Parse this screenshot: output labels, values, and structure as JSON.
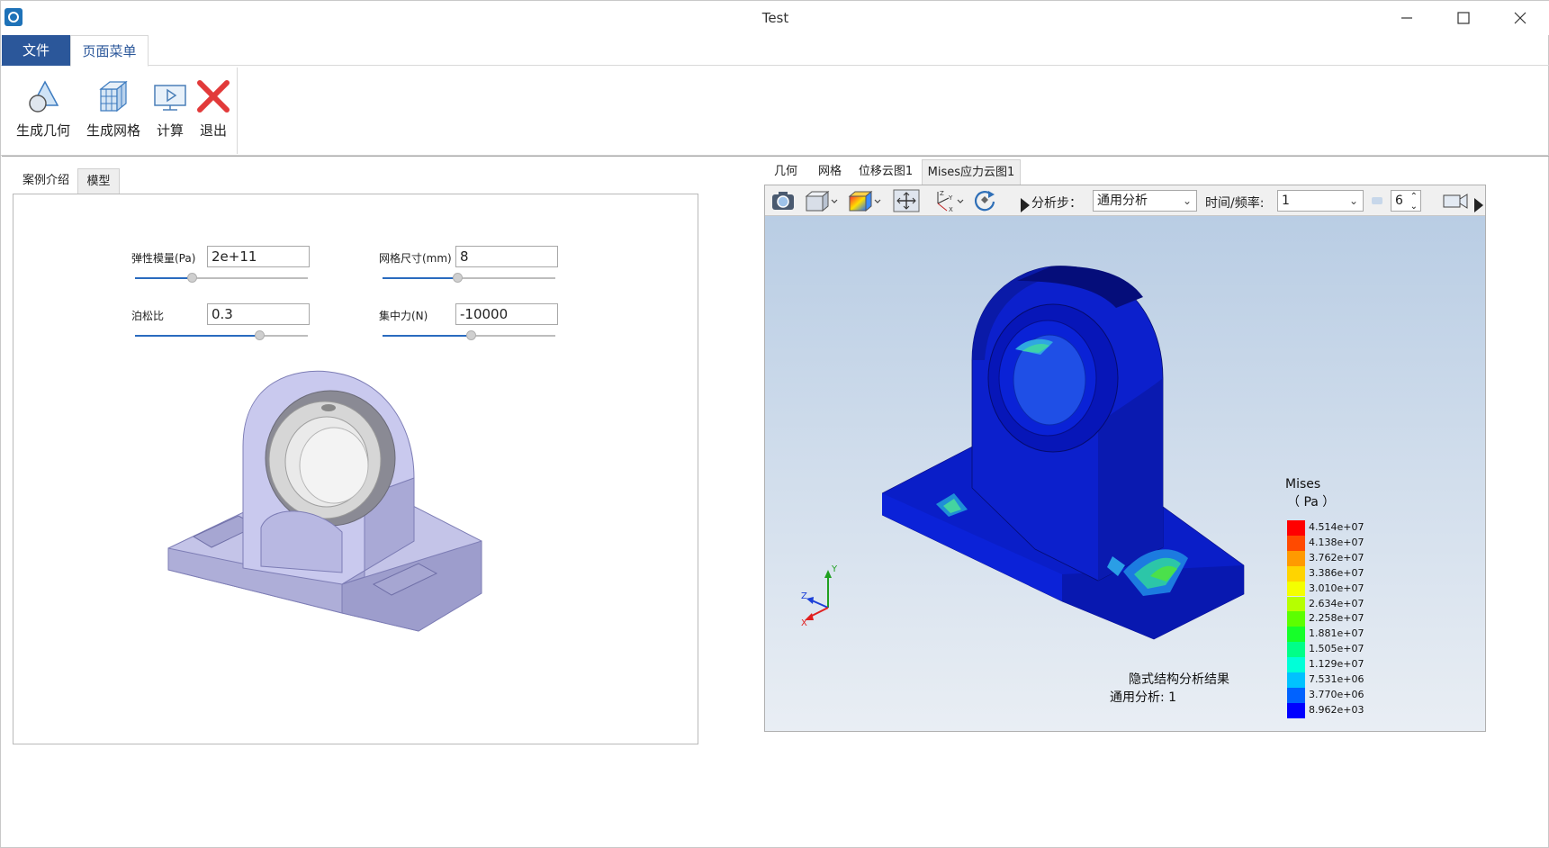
{
  "window": {
    "title": "Test"
  },
  "ribbon": {
    "tabs": [
      {
        "label": "文件"
      },
      {
        "label": "页面菜单"
      }
    ],
    "buttons": [
      {
        "label": "生成几何",
        "icon": "geometry-icon"
      },
      {
        "label": "生成网格",
        "icon": "mesh-icon"
      },
      {
        "label": "计算",
        "icon": "compute-icon"
      },
      {
        "label": "退出",
        "icon": "exit-icon"
      }
    ]
  },
  "left": {
    "tabs": [
      {
        "label": "案例介绍"
      },
      {
        "label": "模型"
      }
    ],
    "active_tab": "模型",
    "params": {
      "elastic_modulus": {
        "label": "弹性模量(Pa)",
        "value": "2e+11",
        "slider": 0.33
      },
      "mesh_size": {
        "label": "网格尺寸(mm)",
        "value": "8",
        "slider": 0.43
      },
      "poisson": {
        "label": "泊松比",
        "value": "0.3",
        "slider": 0.72
      },
      "force": {
        "label": "集中力(N)",
        "value": "-10000",
        "slider": 0.51
      }
    }
  },
  "right": {
    "tabs": [
      {
        "label": "几何"
      },
      {
        "label": "网格"
      },
      {
        "label": "位移云图1"
      },
      {
        "label": "Mises应力云图1"
      }
    ],
    "active_tab": "Mises应力云图1",
    "toolbar": {
      "step_label": "分析步：",
      "step_value": "通用分析",
      "time_label": "时间/频率:",
      "time_value": "1",
      "spin_value": "6"
    },
    "legend": {
      "title": "Mises",
      "unit": "（ Pa ）",
      "values": [
        "4.514e+07",
        "4.138e+07",
        "3.762e+07",
        "3.386e+07",
        "3.010e+07",
        "2.634e+07",
        "2.258e+07",
        "1.881e+07",
        "1.505e+07",
        "1.129e+07",
        "7.531e+06",
        "3.770e+06",
        "8.962e+03"
      ],
      "colors": [
        "#ff0000",
        "#ff4a00",
        "#ff9a00",
        "#ffd400",
        "#f4ff00",
        "#b6ff00",
        "#5cff00",
        "#16ff29",
        "#00ff88",
        "#00ffd8",
        "#00c2ff",
        "#0062ff",
        "#0000ff"
      ]
    },
    "caption_line1": "隐式结构分析结果",
    "caption_line2": "通用分析: 1",
    "axes": {
      "x": "X",
      "y": "Y",
      "z": "Z"
    }
  }
}
